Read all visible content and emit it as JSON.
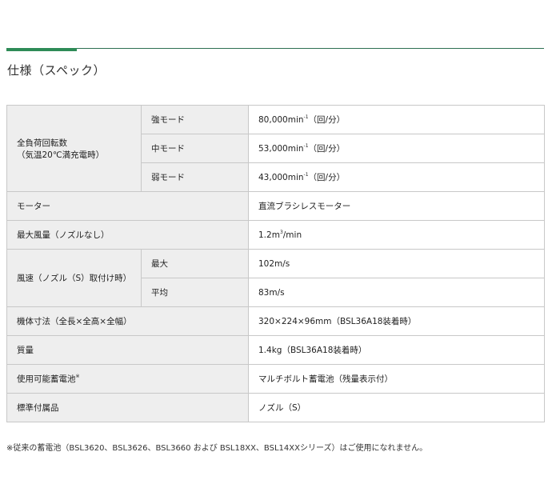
{
  "title": "仕様（スペック）",
  "spec": {
    "speed": {
      "label_line1": "全負荷回転数",
      "label_line2": "（気温20℃満充電時）",
      "rows": [
        {
          "mode": "強モード",
          "value": "80,000min",
          "sup": "-1",
          "unit": "（回/分）"
        },
        {
          "mode": "中モード",
          "value": "53,000min",
          "sup": "-1",
          "unit": "（回/分）"
        },
        {
          "mode": "弱モード",
          "value": "43,000min",
          "sup": "-1",
          "unit": "（回/分）"
        }
      ]
    },
    "motor": {
      "label": "モーター",
      "value": "直流ブラシレスモーター"
    },
    "airflow": {
      "label": "最大風量（ノズルなし）",
      "value_pre": "1.2m",
      "sup": "3",
      "value_post": "/min"
    },
    "windspeed": {
      "label": "風速（ノズル（S）取付け時）",
      "rows": [
        {
          "sub": "最大",
          "value": "102m/s"
        },
        {
          "sub": "平均",
          "value": "83m/s"
        }
      ]
    },
    "dimensions": {
      "label": "機体寸法（全長×全高×全幅）",
      "value": "320×224×96mm（BSL36A18装着時）"
    },
    "weight": {
      "label": "質量",
      "value": "1.4kg（BSL36A18装着時）"
    },
    "battery": {
      "label": "使用可能蓄電池",
      "sup": "※",
      "value": "マルチボルト蓄電池（残量表示付）"
    },
    "accessory": {
      "label": "標準付属品",
      "value": "ノズル（S）"
    }
  },
  "note": "※従来の蓄電池（BSL3620、BSL3626、BSL3660 および BSL18XX、BSL14XXシリーズ）はご使用になれません。"
}
